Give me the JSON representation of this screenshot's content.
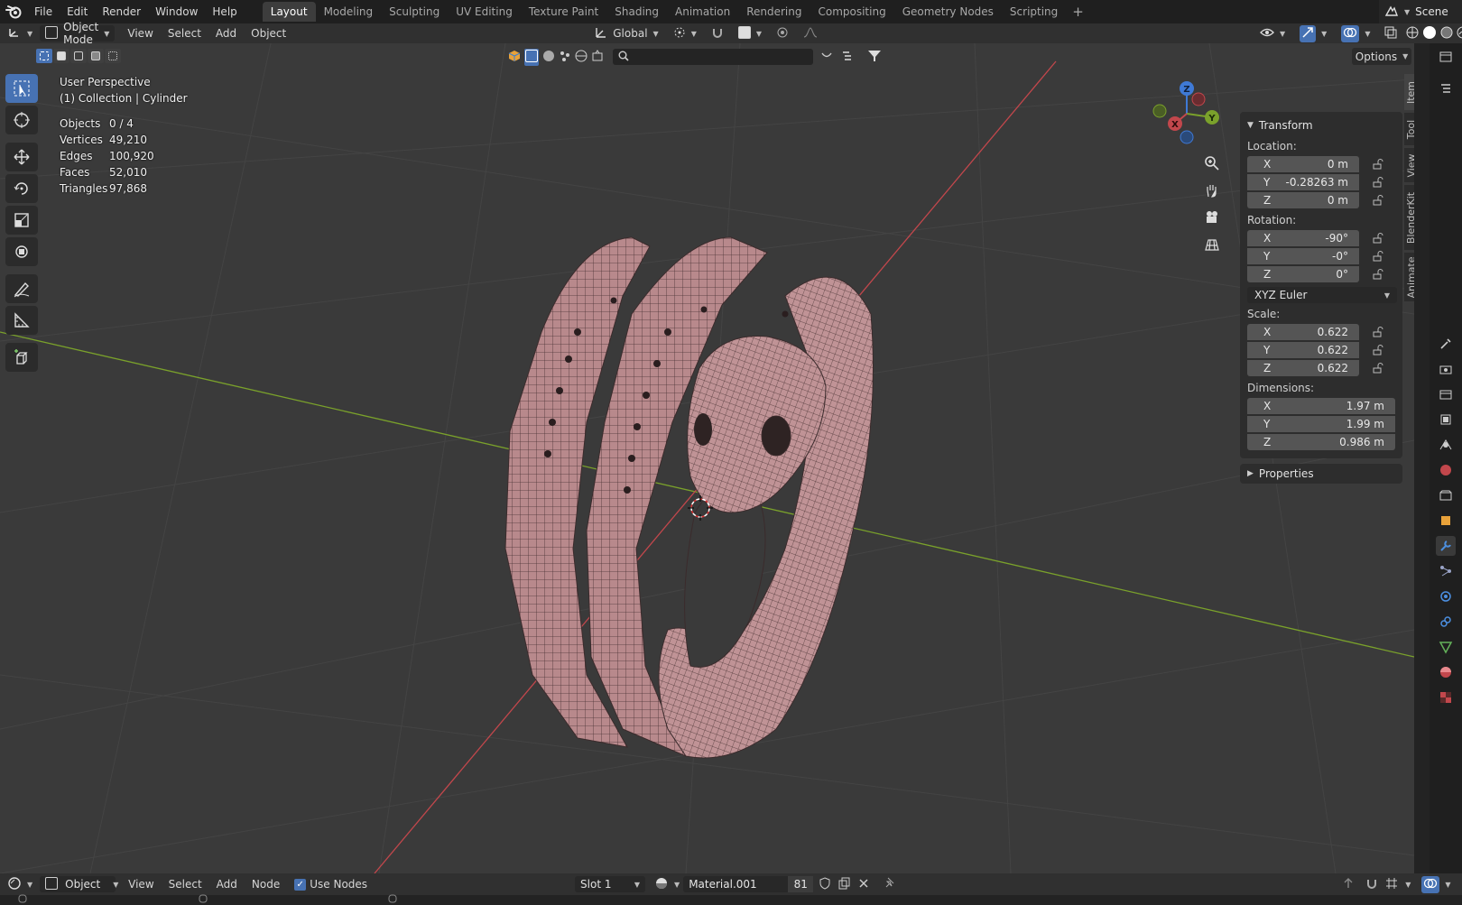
{
  "menubar": {
    "items": [
      "File",
      "Edit",
      "Render",
      "Window",
      "Help"
    ],
    "workspaces": [
      "Layout",
      "Modeling",
      "Sculpting",
      "UV Editing",
      "Texture Paint",
      "Shading",
      "Animation",
      "Rendering",
      "Compositing",
      "Geometry Nodes",
      "Scripting"
    ],
    "active_workspace": "Layout",
    "add_tab": "+",
    "scene_label": "Scene"
  },
  "viewport_header": {
    "mode": "Object Mode",
    "menus": [
      "View",
      "Select",
      "Add",
      "Object"
    ],
    "orientation": "Global",
    "options_label": "Options"
  },
  "viewport": {
    "perspective": "User Perspective",
    "collection": "(1) Collection | Cylinder",
    "stats": [
      {
        "label": "Objects",
        "value": "0 / 4"
      },
      {
        "label": "Vertices",
        "value": "49,210"
      },
      {
        "label": "Edges",
        "value": "100,920"
      },
      {
        "label": "Faces",
        "value": "52,010"
      },
      {
        "label": "Triangles",
        "value": "97,868"
      }
    ],
    "gizmo_axes": {
      "x": "X",
      "y": "Y",
      "z": "Z"
    },
    "colors": {
      "background": "#3a3a3a",
      "x_axis": "#c2474c",
      "y_axis": "#7aa12b",
      "mesh": "#b8898c",
      "wire": "#3b2b2c",
      "accent": "#4772b3"
    }
  },
  "npanel": {
    "transform_title": "Transform",
    "location_label": "Location:",
    "location": [
      {
        "axis": "X",
        "value": "0 m"
      },
      {
        "axis": "Y",
        "value": "-0.28263 m"
      },
      {
        "axis": "Z",
        "value": "0 m"
      }
    ],
    "rotation_label": "Rotation:",
    "rotation": [
      {
        "axis": "X",
        "value": "-90°"
      },
      {
        "axis": "Y",
        "value": "-0°"
      },
      {
        "axis": "Z",
        "value": "0°"
      }
    ],
    "rotation_mode": "XYZ Euler",
    "scale_label": "Scale:",
    "scale": [
      {
        "axis": "X",
        "value": "0.622"
      },
      {
        "axis": "Y",
        "value": "0.622"
      },
      {
        "axis": "Z",
        "value": "0.622"
      }
    ],
    "dimensions_label": "Dimensions:",
    "dimensions": [
      {
        "axis": "X",
        "value": "1.97 m"
      },
      {
        "axis": "Y",
        "value": "1.99 m"
      },
      {
        "axis": "Z",
        "value": "0.986 m"
      }
    ],
    "properties_title": "Properties",
    "side_tabs": [
      "Item",
      "Tool",
      "View",
      "BlenderKit",
      "Animate"
    ]
  },
  "bottom_bar": {
    "editor_mode": "Object",
    "menus": [
      "View",
      "Select",
      "Add",
      "Node"
    ],
    "use_nodes_label": "Use Nodes",
    "use_nodes_checked": true,
    "slot": "Slot 1",
    "material": "Material.001",
    "user_count": "81"
  }
}
